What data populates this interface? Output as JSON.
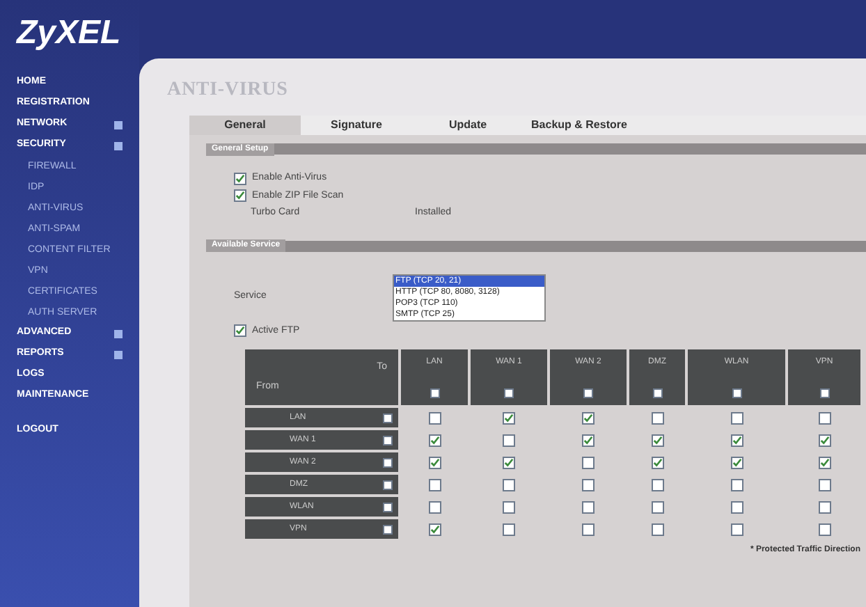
{
  "logo": "ZyXEL",
  "sidebar": {
    "items": [
      {
        "label": "HOME",
        "expandable": false
      },
      {
        "label": "REGISTRATION",
        "expandable": false
      },
      {
        "label": "NETWORK",
        "expandable": true
      },
      {
        "label": "SECURITY",
        "expandable": true,
        "children": [
          {
            "label": "FIREWALL"
          },
          {
            "label": "IDP"
          },
          {
            "label": "ANTI-VIRUS"
          },
          {
            "label": "ANTI-SPAM"
          },
          {
            "label": "CONTENT FILTER"
          },
          {
            "label": "VPN"
          },
          {
            "label": "CERTIFICATES"
          },
          {
            "label": "AUTH SERVER"
          }
        ]
      },
      {
        "label": "ADVANCED",
        "expandable": true
      },
      {
        "label": "REPORTS",
        "expandable": true
      },
      {
        "label": "LOGS",
        "expandable": false
      },
      {
        "label": "MAINTENANCE",
        "expandable": false
      },
      {
        "label": "LOGOUT",
        "expandable": false
      }
    ]
  },
  "page_title": "ANTI-VIRUS",
  "tabs": [
    {
      "label": "General",
      "selected": true
    },
    {
      "label": "Signature",
      "selected": false
    },
    {
      "label": "Update",
      "selected": false
    },
    {
      "label": "Backup & Restore",
      "selected": false
    }
  ],
  "general_setup": {
    "title": "General Setup",
    "options": [
      {
        "label": "Enable Anti-Virus",
        "checked": true
      },
      {
        "label": "Enable ZIP File Scan",
        "checked": true
      }
    ],
    "turbo_card": {
      "label": "Turbo Card",
      "value": "Installed"
    }
  },
  "available_service": {
    "title": "Available Service",
    "service_label": "Service",
    "services": [
      {
        "label": "FTP (TCP 20, 21)",
        "selected": true
      },
      {
        "label": "HTTP (TCP 80, 8080, 3128)",
        "selected": false
      },
      {
        "label": "POP3 (TCP 110)",
        "selected": false
      },
      {
        "label": "SMTP (TCP 25)",
        "selected": false
      }
    ],
    "active": {
      "label": "Active FTP",
      "checked": true
    }
  },
  "matrix": {
    "to_label": "To",
    "from_label": "From",
    "columns": [
      {
        "label": "LAN",
        "checked": false
      },
      {
        "label": "WAN 1",
        "checked": false
      },
      {
        "label": "WAN 2",
        "checked": false
      },
      {
        "label": "DMZ",
        "checked": false
      },
      {
        "label": "WLAN",
        "checked": false
      },
      {
        "label": "VPN",
        "checked": false
      }
    ],
    "rows": [
      {
        "label": "LAN",
        "checked": false,
        "cells": [
          false,
          true,
          true,
          false,
          false,
          false
        ]
      },
      {
        "label": "WAN 1",
        "checked": false,
        "cells": [
          true,
          false,
          true,
          true,
          true,
          true
        ]
      },
      {
        "label": "WAN 2",
        "checked": false,
        "cells": [
          true,
          true,
          false,
          true,
          true,
          true
        ]
      },
      {
        "label": "DMZ",
        "checked": false,
        "cells": [
          false,
          false,
          false,
          false,
          false,
          false
        ]
      },
      {
        "label": "WLAN",
        "checked": false,
        "cells": [
          false,
          false,
          false,
          false,
          false,
          false
        ]
      },
      {
        "label": "VPN",
        "checked": false,
        "cells": [
          true,
          false,
          false,
          false,
          false,
          false
        ]
      }
    ],
    "footnote": "* Protected Traffic Direction"
  }
}
